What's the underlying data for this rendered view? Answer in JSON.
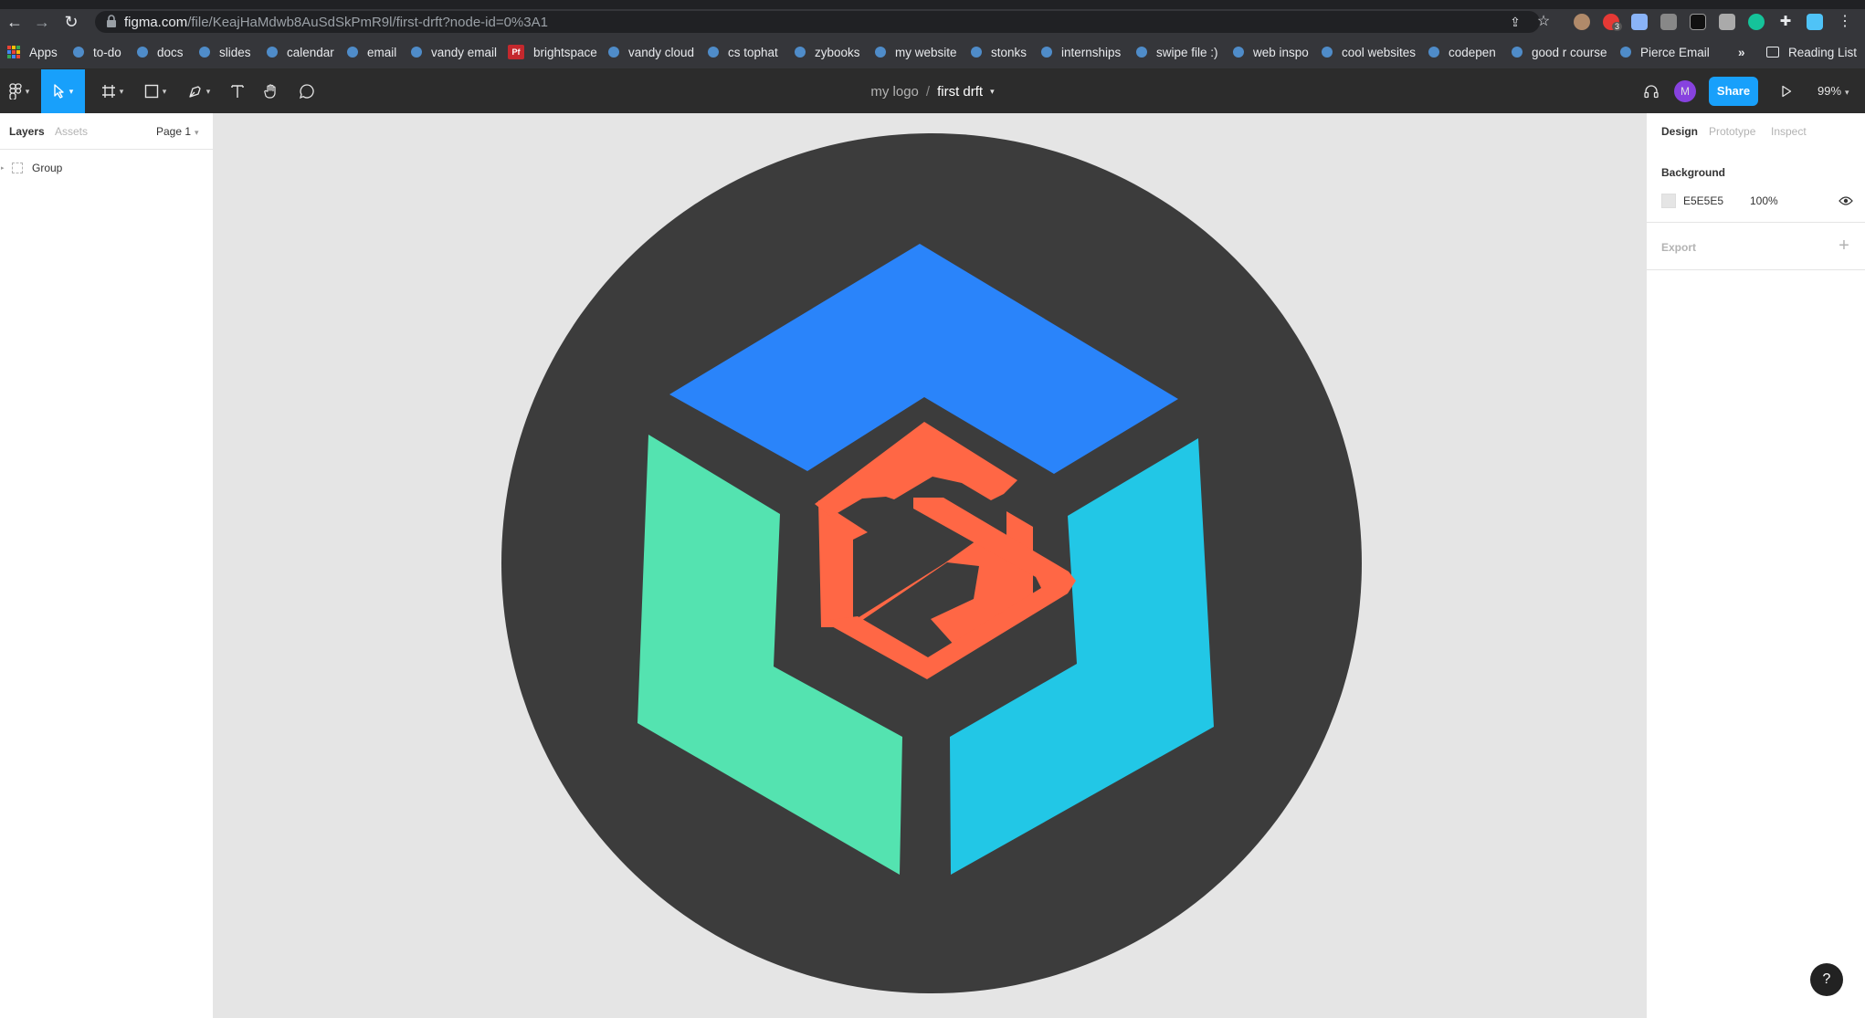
{
  "browser": {
    "url_host": "figma.com",
    "url_path": "/file/KeajHaMdwb8AuSdSkPmR9l/first-drft?node-id=0%3A1",
    "reading_list_label": "Reading List",
    "overflow_label": "»",
    "extension_badge": "3"
  },
  "bookmarks": [
    {
      "label": "Apps"
    },
    {
      "label": "to-do"
    },
    {
      "label": "docs"
    },
    {
      "label": "slides"
    },
    {
      "label": "calendar"
    },
    {
      "label": "email"
    },
    {
      "label": "vandy email"
    },
    {
      "label": "brightspace",
      "icon_text": "Pf"
    },
    {
      "label": "vandy cloud"
    },
    {
      "label": "cs tophat"
    },
    {
      "label": "zybooks"
    },
    {
      "label": "my website"
    },
    {
      "label": "stonks"
    },
    {
      "label": "internships"
    },
    {
      "label": "swipe file :)"
    },
    {
      "label": "web inspo"
    },
    {
      "label": "cool websites"
    },
    {
      "label": "codepen"
    },
    {
      "label": "good r course"
    },
    {
      "label": "Pierce Email"
    }
  ],
  "toolbar": {
    "project_name": "my logo",
    "separator": "/",
    "file_name": "first drft",
    "share_label": "Share",
    "avatar_initial": "M",
    "zoom": "99%"
  },
  "left_panel": {
    "tabs": [
      "Layers",
      "Assets"
    ],
    "page_label": "Page 1",
    "layers": [
      {
        "name": "Group"
      }
    ]
  },
  "right_panel": {
    "tabs": [
      "Design",
      "Prototype",
      "Inspect"
    ],
    "background_title": "Background",
    "background_hex": "E5E5E5",
    "background_opacity": "100%",
    "export_title": "Export",
    "export_add": "+"
  },
  "help_label": "?",
  "colors": {
    "canvas": "#e5e5e5",
    "logo_circle": "#3c3c3c",
    "top_face": "#2a84fa",
    "left_face": "#54e3b0",
    "right_face": "#22c7e6",
    "monogram": "#ff6745",
    "accent": "#18a0fb"
  }
}
